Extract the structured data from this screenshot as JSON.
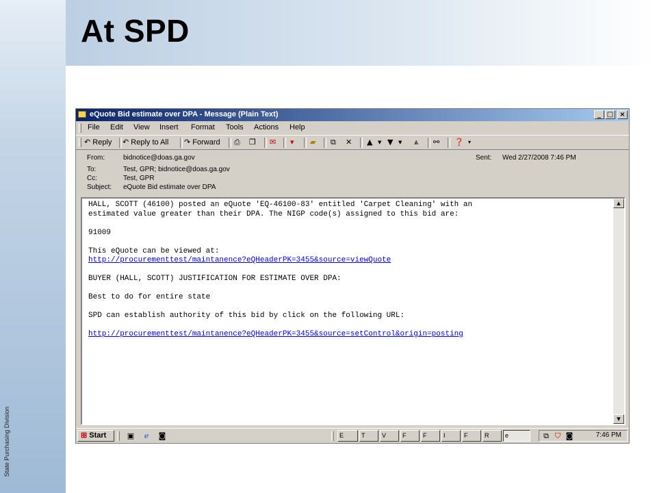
{
  "slide": {
    "title": "At SPD",
    "side_label": "State Purchasing Division"
  },
  "window": {
    "title": "eQuote Bid estimate over DPA - Message (Plain Text)",
    "controls": {
      "minimize": "_",
      "maximize": "□",
      "close": "×"
    },
    "menu": [
      "File",
      "Edit",
      "View",
      "Insert",
      "Format",
      "Tools",
      "Actions",
      "Help"
    ],
    "toolbar": {
      "reply": "Reply",
      "reply_all": "Reply to All",
      "forward": "Forward"
    }
  },
  "message": {
    "from_label": "From:",
    "from": "bidnotice@doas.ga.gov",
    "to_label": "To:",
    "to": "Test, GPR; bidnotice@doas.ga.gov",
    "cc_label": "Cc:",
    "cc": "Test, GPR",
    "subject_label": "Subject:",
    "subject": "eQuote Bid estimate over DPA",
    "sent_label": "Sent:",
    "sent": "Wed 2/27/2008 7:46 PM",
    "body": {
      "line1": "HALL, SCOTT (46100) posted an eQuote 'EQ-46100-83' entitled 'Carpet Cleaning' with an",
      "line2": "estimated value greater than their DPA. The NIGP code(s) assigned to this bid are:",
      "nigp": "91009",
      "view_intro": "This eQuote can be viewed at:",
      "view_link": "http://procurementtest/maintanence?eQHeaderPK=3455&source=viewQuote",
      "justification": "BUYER (HALL, SCOTT) JUSTIFICATION FOR ESTIMATE OVER DPA:",
      "justification_text": "Best to do for entire state",
      "spd_intro": "SPD can establish authority of this bid by click on the following URL:",
      "spd_link": "http://procurementtest/maintanence?eQHeaderPK=3455&source=setControl&origin=posting"
    }
  },
  "taskbar": {
    "start": "Start",
    "tasks": [
      "E",
      "T",
      "V",
      "F",
      "F",
      "I",
      "F",
      "R",
      "e"
    ],
    "clock": "7:46 PM"
  }
}
